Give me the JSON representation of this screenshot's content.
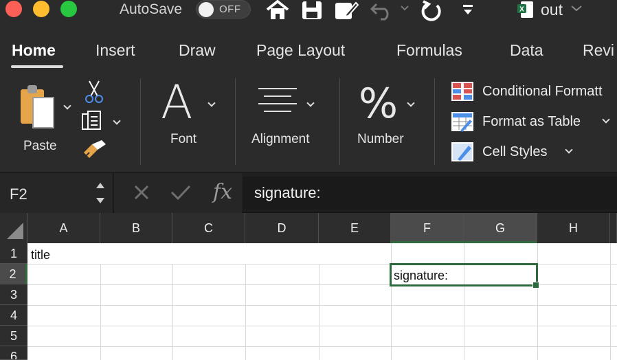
{
  "titlebar": {
    "autosave_label": "AutoSave",
    "autosave_state": "OFF",
    "file_name": "out"
  },
  "tabs": [
    {
      "label": "Home",
      "active": true
    },
    {
      "label": "Insert"
    },
    {
      "label": "Draw"
    },
    {
      "label": "Page Layout"
    },
    {
      "label": "Formulas"
    },
    {
      "label": "Data"
    },
    {
      "label": "Revi"
    }
  ],
  "ribbon": {
    "paste_label": "Paste",
    "font_label": "Font",
    "font_glyph": "A",
    "alignment_label": "Alignment",
    "number_label": "Number",
    "number_glyph": "%",
    "conditional_formatting": "Conditional Formatt",
    "format_as_table": "Format as Table",
    "cell_styles": "Cell Styles"
  },
  "formula_bar": {
    "name_box": "F2",
    "fx": "fx",
    "value": "signature:"
  },
  "grid": {
    "columns": [
      "A",
      "B",
      "C",
      "D",
      "E",
      "F",
      "G",
      "H"
    ],
    "selected_columns": [
      "F",
      "G"
    ],
    "rows": [
      "1",
      "2",
      "3",
      "4",
      "5",
      "6"
    ],
    "selected_row": "2",
    "cells": {
      "A1": "title",
      "F2": "signature:"
    }
  },
  "colors": {
    "selection_green": "#2f6a3f",
    "ribbon_bg": "#2b2b2b"
  }
}
